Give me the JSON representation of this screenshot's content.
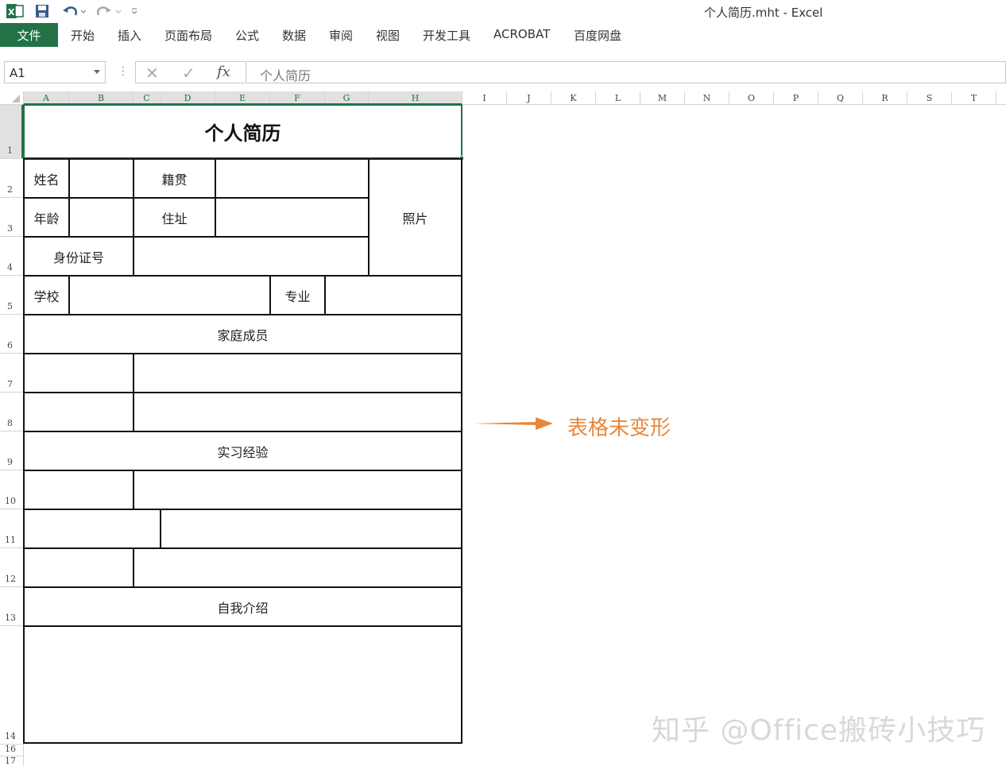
{
  "window": {
    "title": "个人简历.mht - Excel"
  },
  "ribbon": {
    "file_tab": "文件",
    "tabs": [
      "开始",
      "插入",
      "页面布局",
      "公式",
      "数据",
      "审阅",
      "视图",
      "开发工具",
      "ACROBAT",
      "百度网盘"
    ]
  },
  "formula_bar": {
    "name_box": "A1",
    "fx_label": "fx",
    "formula": "个人简历"
  },
  "sheet": {
    "columns": [
      "A",
      "B",
      "C",
      "D",
      "E",
      "F",
      "G",
      "H",
      "I",
      "J",
      "K",
      "L",
      "M",
      "N",
      "O",
      "P",
      "Q",
      "R",
      "S",
      "T"
    ],
    "rows": [
      "1",
      "2",
      "3",
      "4",
      "5",
      "6",
      "7",
      "8",
      "9",
      "10",
      "11",
      "12",
      "13",
      "14",
      "16",
      "17"
    ],
    "title": "个人简历",
    "labels": {
      "name": "姓名",
      "native_place": "籍贯",
      "age": "年龄",
      "address": "住址",
      "photo": "照片",
      "id_number": "身份证号",
      "school": "学校",
      "major": "专业",
      "family": "家庭成员",
      "internship": "实习经验",
      "self_intro": "自我介绍"
    }
  },
  "annotation": {
    "text": "表格未变形",
    "color": "#e8873a"
  },
  "watermark": "知乎 @Office搬砖小技巧",
  "colors": {
    "accent": "#217346",
    "annotation": "#e8873a"
  }
}
